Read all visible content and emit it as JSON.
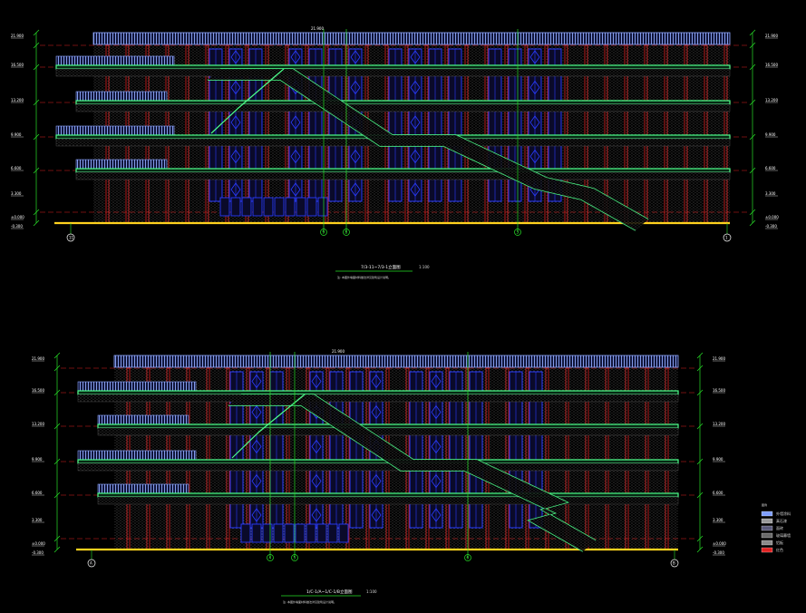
{
  "colors": {
    "background": "#000000",
    "parapet": "#7f9fff",
    "window_blue": "#2a3cff",
    "column_red": "#e02222",
    "slab_green": "#4cff8a",
    "dim_green": "#27e027",
    "hatch": "#9a9a9a",
    "ground_yellow": "#ffd21e",
    "text": "#d8d8d8"
  },
  "elevations": [
    {
      "title": "7/3-11~7/3-1立面图",
      "scale": "1:100",
      "note": "注: 本图外墙面材料做法详见建筑设计说明。",
      "top_label": "21.900",
      "levels": [
        "21.900",
        "16.500",
        "13.200",
        "9.900",
        "6.600",
        "3.300",
        "±0.000",
        "-0.300"
      ],
      "axis_left": "11",
      "axis_right": "1",
      "axis_mid": [
        "9",
        "8",
        "3"
      ]
    },
    {
      "title": "1/C-1/A~1/C-1/B立面图",
      "scale": "1:100",
      "note": "注: 本图外墙面材料做法详见建筑设计说明。",
      "top_label": "21.900",
      "levels": [
        "21.900",
        "16.500",
        "13.200",
        "9.900",
        "6.600",
        "3.300",
        "±0.000",
        "-0.300"
      ],
      "axis_left": "A",
      "axis_right": "B",
      "axis_mid": [
        "4",
        "5",
        "6"
      ]
    }
  ],
  "legend": {
    "title": "图例",
    "items": [
      {
        "label": "外墙涂料",
        "color": "#7f9fff"
      },
      {
        "label": "真石漆",
        "color": "#9a9a9a"
      },
      {
        "label": "面砖",
        "color": "#5a5a7a"
      },
      {
        "label": "玻璃幕墙",
        "color": "#6a6a6a"
      },
      {
        "label": "铝板",
        "color": "#8a8a8a"
      },
      {
        "label": "红色",
        "color": "#e02222"
      }
    ]
  }
}
